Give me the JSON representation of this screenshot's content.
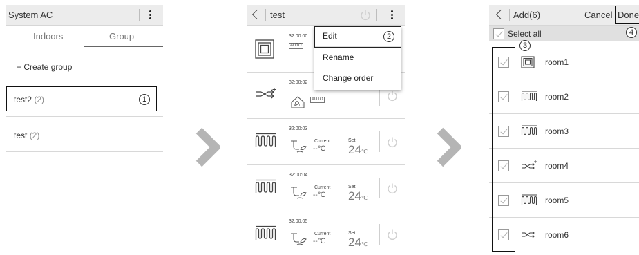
{
  "screen1": {
    "title": "System AC",
    "tabs": [
      "Indoors",
      "Group"
    ],
    "create_group": "+ Create group",
    "groups": [
      {
        "name": "test2",
        "count": "(2)"
      },
      {
        "name": "test",
        "count": "(2)"
      }
    ],
    "step_marker": "1"
  },
  "screen2": {
    "title": "test",
    "menu": [
      "Edit",
      "Rename",
      "Change order"
    ],
    "step_marker": "2",
    "devices": [
      {
        "time": "32:00:00",
        "icon": "square-ac-icon",
        "mode": "AUTO"
      },
      {
        "time": "32:00:02",
        "icon": "fan-mixer-icon",
        "mode": "AUTO",
        "mode2": "AUTO"
      },
      {
        "time": "32:00:03",
        "icon": "heater-icon",
        "current_label": "Current",
        "current_value": "--℃",
        "set_label": "Set",
        "set_value": "24",
        "unit": "℃"
      },
      {
        "time": "32:00:04",
        "icon": "heater-icon",
        "current_label": "Current",
        "current_value": "--℃",
        "set_label": "Set",
        "set_value": "24",
        "unit": "℃"
      },
      {
        "time": "32:00:05",
        "icon": "heater-icon",
        "current_label": "Current",
        "current_value": "--℃",
        "set_label": "Set",
        "set_value": "24",
        "unit": "℃"
      }
    ]
  },
  "screen3": {
    "title": "Add(6)",
    "cancel": "Cancel",
    "done": "Done",
    "select_all": "Select all",
    "step_marker_3": "3",
    "step_marker_4": "4",
    "rooms": [
      "room1",
      "room2",
      "room3",
      "room4",
      "room5",
      "room6"
    ],
    "room_icons": [
      "square-ac-icon",
      "heater-icon",
      "heater-icon",
      "fan-mixer-icon",
      "heater-icon",
      "fan-mixer-icon"
    ]
  },
  "colors": {
    "header_bg": "#ececec",
    "chevron": "#b5b5b5",
    "highlight_border": "#111111"
  }
}
